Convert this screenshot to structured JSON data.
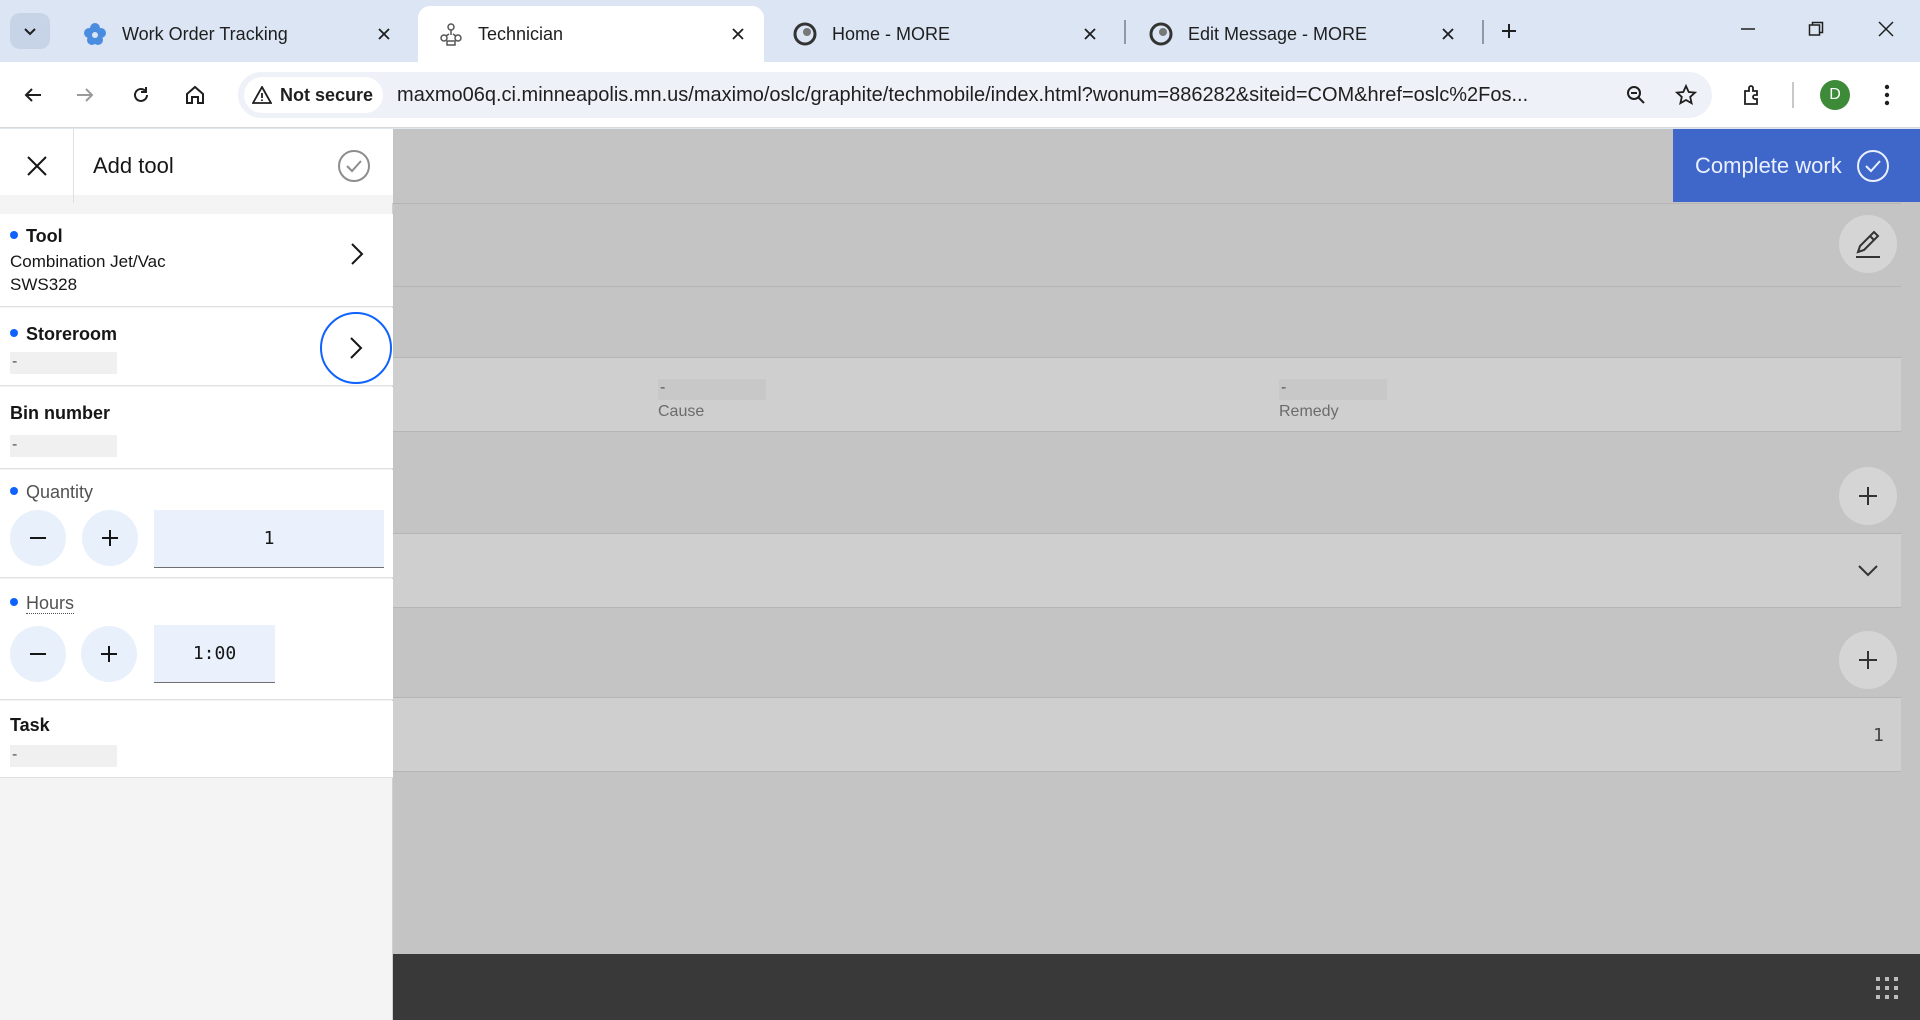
{
  "browser": {
    "tabs": [
      {
        "title": "Work Order Tracking",
        "icon": "flower-icon",
        "active": false
      },
      {
        "title": "Technician",
        "icon": "technician-icon",
        "active": true
      },
      {
        "title": "Home - MORE",
        "icon": "more-logo-icon",
        "active": false
      },
      {
        "title": "Edit Message - MORE",
        "icon": "more-logo-icon",
        "active": false
      }
    ],
    "security_label": "Not secure",
    "url": "maxmo06q.ci.minneapolis.mn.us/maximo/oslc/graphite/techmobile/index.html?wonum=886282&siteid=COM&href=oslc%2Fos...",
    "profile_initial": "D",
    "colors": {
      "tabbar": "#dbe5f4",
      "avatar": "#3d8a38"
    }
  },
  "app": {
    "complete_work_label": "Complete work",
    "cause_value": "-",
    "cause_label": "Cause",
    "remedy_value": "-",
    "remedy_label": "Remedy",
    "count_value": "1",
    "accent_color": "#3f67c9"
  },
  "panel": {
    "title": "Add tool",
    "tool": {
      "label": "Tool",
      "name": "Combination Jet/Vac",
      "code": "SWS328"
    },
    "storeroom": {
      "label": "Storeroom",
      "value": "-"
    },
    "bin": {
      "label": "Bin number",
      "value": "-"
    },
    "quantity": {
      "label": "Quantity",
      "value": "1"
    },
    "hours": {
      "label": "Hours",
      "value": "1:00"
    },
    "task": {
      "label": "Task",
      "value": "-"
    },
    "required_dot_color": "#0f62fe"
  }
}
